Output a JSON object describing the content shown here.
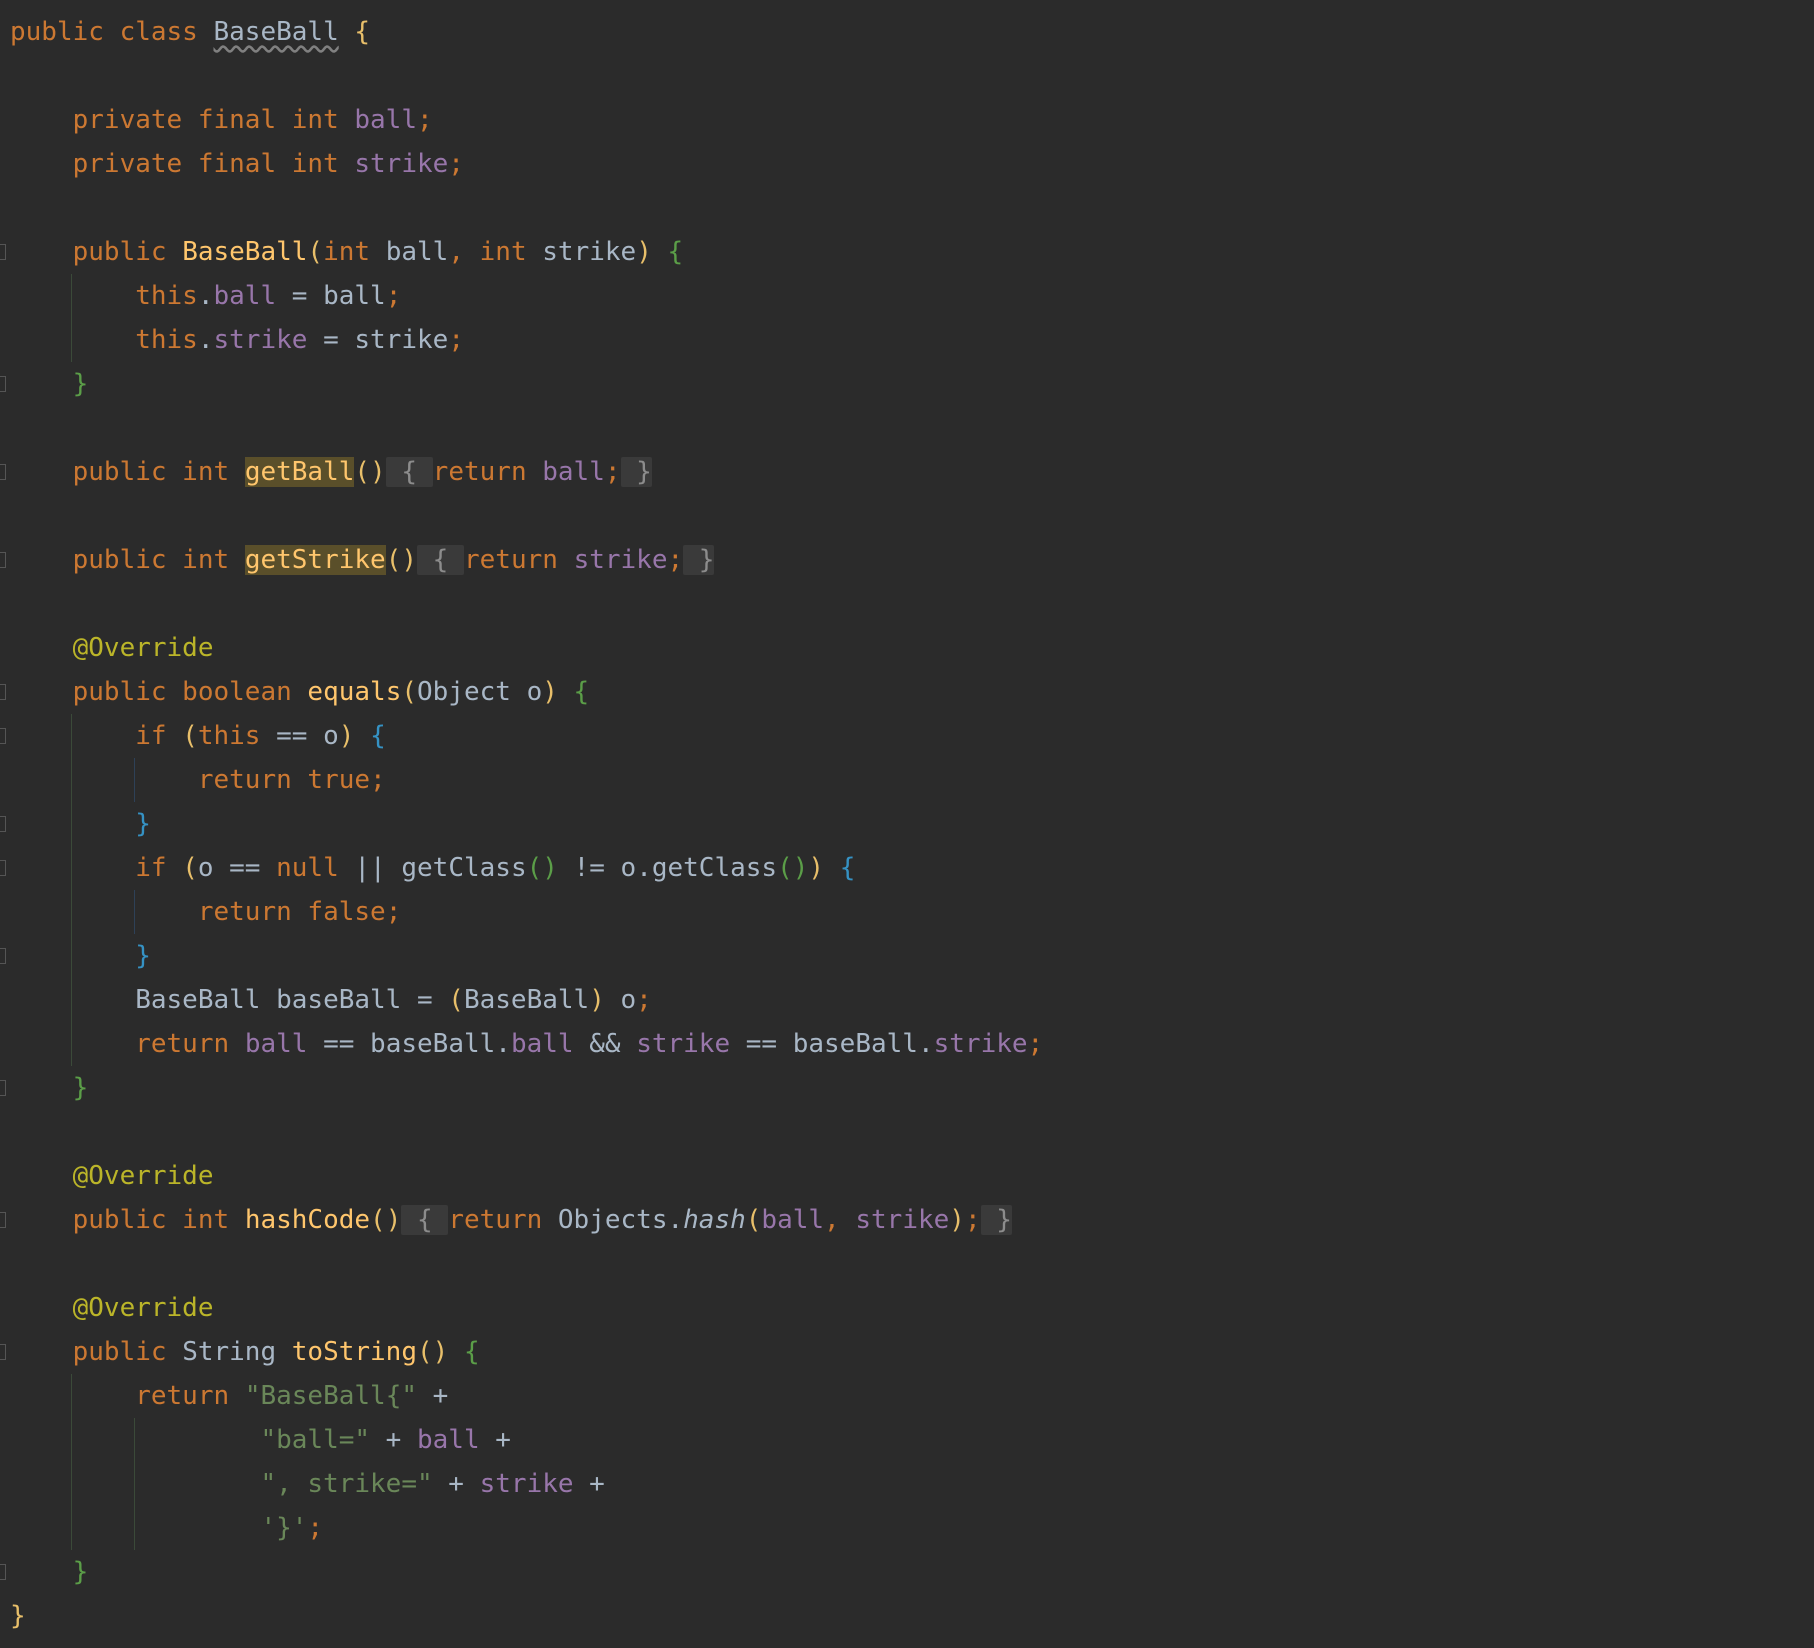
{
  "editor": {
    "language": "java",
    "highlighted_occurrences": [
      "getBall",
      "getStrike"
    ],
    "lines": [
      [
        {
          "t": "public class ",
          "c": "kw"
        },
        {
          "t": "BaseBall",
          "c": "df wavy"
        },
        {
          "t": " ",
          "c": "df"
        },
        {
          "t": "{",
          "c": "b1"
        }
      ],
      [],
      [
        {
          "t": "    private final int ",
          "c": "kw"
        },
        {
          "t": "ball",
          "c": "fld"
        },
        {
          "t": ";",
          "c": "kw"
        }
      ],
      [
        {
          "t": "    private final int ",
          "c": "kw"
        },
        {
          "t": "strike",
          "c": "fld"
        },
        {
          "t": ";",
          "c": "kw"
        }
      ],
      [],
      [
        {
          "t": "    public ",
          "c": "kw"
        },
        {
          "t": "BaseBall",
          "c": "fn"
        },
        {
          "t": "(",
          "c": "b1"
        },
        {
          "t": "int ",
          "c": "kw"
        },
        {
          "t": "ball",
          "c": "df"
        },
        {
          "t": ", ",
          "c": "kw"
        },
        {
          "t": "int ",
          "c": "kw"
        },
        {
          "t": "strike",
          "c": "df"
        },
        {
          "t": ")",
          "c": "b1"
        },
        {
          "t": " ",
          "c": "df"
        },
        {
          "t": "{",
          "c": "b2"
        }
      ],
      [
        {
          "t": "        this",
          "c": "kw"
        },
        {
          "t": ".",
          "c": "df"
        },
        {
          "t": "ball",
          "c": "fld"
        },
        {
          "t": " = ",
          "c": "df"
        },
        {
          "t": "ball",
          "c": "df"
        },
        {
          "t": ";",
          "c": "kw"
        }
      ],
      [
        {
          "t": "        this",
          "c": "kw"
        },
        {
          "t": ".",
          "c": "df"
        },
        {
          "t": "strike",
          "c": "fld"
        },
        {
          "t": " = ",
          "c": "df"
        },
        {
          "t": "strike",
          "c": "df"
        },
        {
          "t": ";",
          "c": "kw"
        }
      ],
      [
        {
          "t": "    ",
          "c": "df"
        },
        {
          "t": "}",
          "c": "b2"
        }
      ],
      [],
      [
        {
          "t": "    public int ",
          "c": "kw"
        },
        {
          "t": "getBall",
          "c": "fn hl"
        },
        {
          "t": "()",
          "c": "b1"
        },
        {
          "t": " { ",
          "c": "fold"
        },
        {
          "t": "return ",
          "c": "kw"
        },
        {
          "t": "ball",
          "c": "fld"
        },
        {
          "t": ";",
          "c": "kw"
        },
        {
          "t": " }",
          "c": "fold"
        }
      ],
      [],
      [
        {
          "t": "    public int ",
          "c": "kw"
        },
        {
          "t": "getStrike",
          "c": "fn hl"
        },
        {
          "t": "()",
          "c": "b1"
        },
        {
          "t": " { ",
          "c": "fold"
        },
        {
          "t": "return ",
          "c": "kw"
        },
        {
          "t": "strike",
          "c": "fld"
        },
        {
          "t": ";",
          "c": "kw"
        },
        {
          "t": " }",
          "c": "fold"
        }
      ],
      [],
      [
        {
          "t": "    @Override",
          "c": "ann"
        }
      ],
      [
        {
          "t": "    public boolean ",
          "c": "kw"
        },
        {
          "t": "equals",
          "c": "fn"
        },
        {
          "t": "(",
          "c": "b1"
        },
        {
          "t": "Object ",
          "c": "cls"
        },
        {
          "t": "o",
          "c": "df"
        },
        {
          "t": ")",
          "c": "b1"
        },
        {
          "t": " ",
          "c": "df"
        },
        {
          "t": "{",
          "c": "b2"
        }
      ],
      [
        {
          "t": "        if ",
          "c": "kw"
        },
        {
          "t": "(",
          "c": "b1"
        },
        {
          "t": "this",
          "c": "kw"
        },
        {
          "t": " == ",
          "c": "df"
        },
        {
          "t": "o",
          "c": "df"
        },
        {
          "t": ")",
          "c": "b1"
        },
        {
          "t": " ",
          "c": "df"
        },
        {
          "t": "{",
          "c": "b3"
        }
      ],
      [
        {
          "t": "            return true",
          "c": "kw"
        },
        {
          "t": ";",
          "c": "kw"
        }
      ],
      [
        {
          "t": "        ",
          "c": "df"
        },
        {
          "t": "}",
          "c": "b3"
        }
      ],
      [
        {
          "t": "        if ",
          "c": "kw"
        },
        {
          "t": "(",
          "c": "b1"
        },
        {
          "t": "o == ",
          "c": "df"
        },
        {
          "t": "null",
          "c": "kw"
        },
        {
          "t": " || ",
          "c": "df"
        },
        {
          "t": "getClass",
          "c": "df"
        },
        {
          "t": "()",
          "c": "b2"
        },
        {
          "t": " != o.",
          "c": "df"
        },
        {
          "t": "getClass",
          "c": "df"
        },
        {
          "t": "()",
          "c": "b2"
        },
        {
          "t": ")",
          "c": "b1"
        },
        {
          "t": " ",
          "c": "df"
        },
        {
          "t": "{",
          "c": "b3"
        }
      ],
      [
        {
          "t": "            return false",
          "c": "kw"
        },
        {
          "t": ";",
          "c": "kw"
        }
      ],
      [
        {
          "t": "        ",
          "c": "df"
        },
        {
          "t": "}",
          "c": "b3"
        }
      ],
      [
        {
          "t": "        BaseBall baseBall = ",
          "c": "df"
        },
        {
          "t": "(",
          "c": "b1"
        },
        {
          "t": "BaseBall",
          "c": "df"
        },
        {
          "t": ")",
          "c": "b1"
        },
        {
          "t": " o",
          "c": "df"
        },
        {
          "t": ";",
          "c": "kw"
        }
      ],
      [
        {
          "t": "        return ",
          "c": "kw"
        },
        {
          "t": "ball",
          "c": "fld"
        },
        {
          "t": " == baseBall.",
          "c": "df"
        },
        {
          "t": "ball",
          "c": "fld"
        },
        {
          "t": " && ",
          "c": "df"
        },
        {
          "t": "strike",
          "c": "fld"
        },
        {
          "t": " == baseBall.",
          "c": "df"
        },
        {
          "t": "strike",
          "c": "fld"
        },
        {
          "t": ";",
          "c": "kw"
        }
      ],
      [
        {
          "t": "    ",
          "c": "df"
        },
        {
          "t": "}",
          "c": "b2"
        }
      ],
      [],
      [
        {
          "t": "    @Override",
          "c": "ann"
        }
      ],
      [
        {
          "t": "    public int ",
          "c": "kw"
        },
        {
          "t": "hashCode",
          "c": "fn"
        },
        {
          "t": "()",
          "c": "b1"
        },
        {
          "t": " { ",
          "c": "fold"
        },
        {
          "t": "return ",
          "c": "kw"
        },
        {
          "t": "Objects.",
          "c": "df"
        },
        {
          "t": "hash",
          "c": "df italic"
        },
        {
          "t": "(",
          "c": "b1"
        },
        {
          "t": "ball",
          "c": "fld"
        },
        {
          "t": ", ",
          "c": "kw"
        },
        {
          "t": "strike",
          "c": "fld"
        },
        {
          "t": ")",
          "c": "b1"
        },
        {
          "t": ";",
          "c": "kw"
        },
        {
          "t": " }",
          "c": "fold"
        }
      ],
      [],
      [
        {
          "t": "    @Override",
          "c": "ann"
        }
      ],
      [
        {
          "t": "    public ",
          "c": "kw"
        },
        {
          "t": "String ",
          "c": "cls"
        },
        {
          "t": "toString",
          "c": "fn"
        },
        {
          "t": "()",
          "c": "b1"
        },
        {
          "t": " ",
          "c": "df"
        },
        {
          "t": "{",
          "c": "b2"
        }
      ],
      [
        {
          "t": "        return ",
          "c": "kw"
        },
        {
          "t": "\"BaseBall{\"",
          "c": "str"
        },
        {
          "t": " +",
          "c": "df"
        }
      ],
      [
        {
          "t": "                ",
          "c": "df"
        },
        {
          "t": "\"ball=\"",
          "c": "str"
        },
        {
          "t": " + ",
          "c": "df"
        },
        {
          "t": "ball",
          "c": "fld"
        },
        {
          "t": " +",
          "c": "df"
        }
      ],
      [
        {
          "t": "                ",
          "c": "df"
        },
        {
          "t": "\", strike=\"",
          "c": "str"
        },
        {
          "t": " + ",
          "c": "df"
        },
        {
          "t": "strike",
          "c": "fld"
        },
        {
          "t": " +",
          "c": "df"
        }
      ],
      [
        {
          "t": "                ",
          "c": "df"
        },
        {
          "t": "'}'",
          "c": "str"
        },
        {
          "t": ";",
          "c": "kw"
        }
      ],
      [
        {
          "t": "    ",
          "c": "df"
        },
        {
          "t": "}",
          "c": "b2"
        }
      ],
      [
        {
          "t": "}",
          "c": "b1"
        }
      ]
    ]
  },
  "colors": {
    "background": "#2b2b2b",
    "keyword": "#cc7832",
    "field": "#9876aa",
    "method_declaration": "#ffc66d",
    "default_text": "#a9b7c6",
    "annotation": "#bbb529",
    "string": "#6a8759",
    "brace_level_1": "#e8bf6a",
    "brace_level_2": "#5b9e48",
    "brace_level_3": "#3592c4",
    "occurrence_highlight": "#5a4f2a",
    "folded_region": "#3a3a3a"
  }
}
